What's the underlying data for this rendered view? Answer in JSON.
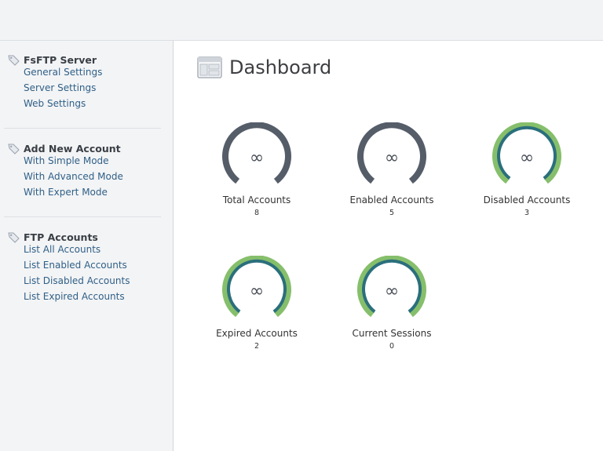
{
  "sidebar": {
    "sections": [
      {
        "title": "FsFTP Server",
        "items": [
          "General Settings",
          "Server Settings",
          "Web Settings"
        ]
      },
      {
        "title": "Add New Account",
        "items": [
          "With Simple Mode",
          "With Advanced Mode",
          "With Expert Mode"
        ]
      },
      {
        "title": "FTP Accounts",
        "items": [
          "List All Accounts",
          "List Enabled Accounts",
          "List Disabled Accounts",
          "List Expired Accounts"
        ]
      }
    ]
  },
  "main": {
    "title": "Dashboard",
    "gauges": [
      {
        "label": "Total Accounts",
        "value": "8",
        "symbol": "∞",
        "style": "gray"
      },
      {
        "label": "Enabled Accounts",
        "value": "5",
        "symbol": "∞",
        "style": "gray"
      },
      {
        "label": "Disabled Accounts",
        "value": "3",
        "symbol": "∞",
        "style": "green"
      },
      {
        "label": "Expired Accounts",
        "value": "2",
        "symbol": "∞",
        "style": "green"
      },
      {
        "label": "Current Sessions",
        "value": "0",
        "symbol": "∞",
        "style": "green"
      }
    ]
  },
  "colors": {
    "gauge_gray": "#555d69",
    "gauge_green_outer": "#86bf6b",
    "gauge_teal_inner": "#2b6f7c",
    "link": "#2f5f86"
  },
  "icons": {
    "section": "tag-icon",
    "page": "dashboard-window-icon"
  }
}
